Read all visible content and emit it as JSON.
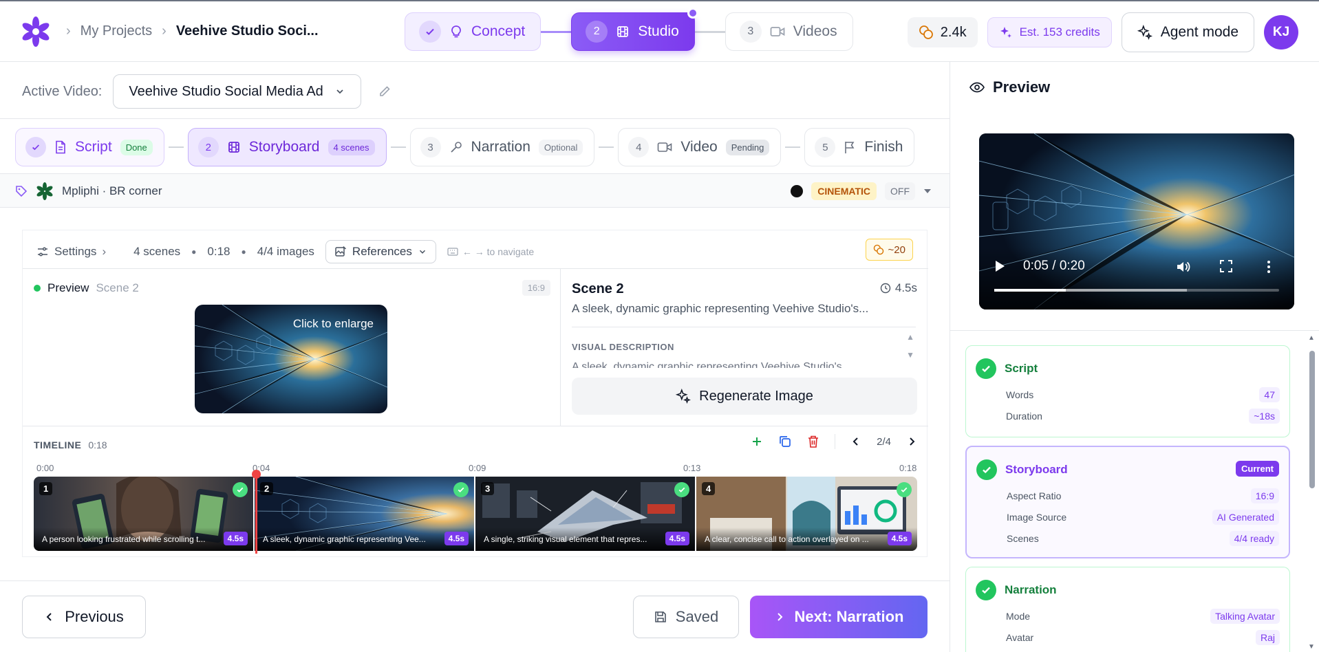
{
  "header": {
    "breadcrumb": [
      "My Projects",
      "Veehive Studio Soci..."
    ],
    "steps": [
      {
        "label": "Concept",
        "state": "done"
      },
      {
        "num": "2",
        "label": "Studio",
        "state": "active"
      },
      {
        "num": "3",
        "label": "Videos",
        "state": "pending"
      }
    ],
    "credits": "2.4k",
    "estimate": "Est. 153 credits",
    "agent_mode": "Agent mode",
    "avatar": "KJ"
  },
  "active_video": {
    "label": "Active Video:",
    "value": "Veehive Studio Social Media Ad"
  },
  "substeps": [
    {
      "label": "Script",
      "badge": "Done"
    },
    {
      "num": "2",
      "label": "Storyboard",
      "badge": "4 scenes"
    },
    {
      "num": "3",
      "label": "Narration",
      "badge": "Optional"
    },
    {
      "num": "4",
      "label": "Video",
      "badge": "Pending"
    },
    {
      "num": "5",
      "label": "Finish"
    }
  ],
  "brand_bar": {
    "text": "Mpliphi · BR corner",
    "style": "CINEMATIC",
    "toggle": "OFF"
  },
  "toolbar": {
    "settings": "Settings",
    "scenes": "4 scenes",
    "duration": "0:18",
    "images": "4/4 images",
    "references": "References",
    "hint": "← → to navigate",
    "cost": "~20"
  },
  "preview": {
    "title": "Preview",
    "scene": "Scene 2",
    "ratio": "16:9",
    "enlarge": "Click to enlarge"
  },
  "scene": {
    "title": "Scene 2",
    "duration": "4.5s",
    "summary": "A sleek, dynamic graphic representing Veehive Studio's...",
    "vd_label": "VISUAL DESCRIPTION",
    "vd_text": "A sleek, dynamic graphic representing Veehive Studio's",
    "regenerate": "Regenerate Image"
  },
  "timeline": {
    "label": "TIMELINE",
    "duration": "0:18",
    "position": "2/4",
    "ticks": [
      "0:00",
      "0:04",
      "0:09",
      "0:13",
      "0:18"
    ],
    "clips": [
      {
        "n": "1",
        "caption": "A person looking frustrated while scrolling t...",
        "dur": "4.5s"
      },
      {
        "n": "2",
        "caption": "A sleek, dynamic graphic representing Vee...",
        "dur": "4.5s"
      },
      {
        "n": "3",
        "caption": "A single, striking visual element that repres...",
        "dur": "4.5s"
      },
      {
        "n": "4",
        "caption": "A clear, concise call to action overlayed on ...",
        "dur": "4.5s"
      }
    ]
  },
  "footer": {
    "previous": "Previous",
    "saved": "Saved",
    "next": "Next: Narration"
  },
  "right_panel": {
    "title": "Preview",
    "video_time": "0:05 / 0:20",
    "progress": 0.25,
    "script": {
      "title": "Script",
      "words_label": "Words",
      "words": "47",
      "duration_label": "Duration",
      "duration": "~18s"
    },
    "storyboard": {
      "title": "Storyboard",
      "badge": "Current",
      "aspect_label": "Aspect Ratio",
      "aspect": "16:9",
      "source_label": "Image Source",
      "source": "AI Generated",
      "scenes_label": "Scenes",
      "scenes": "4/4 ready"
    },
    "narration": {
      "title": "Narration",
      "mode_label": "Mode",
      "mode": "Talking Avatar",
      "avatar_label": "Avatar",
      "avatar": "Raj"
    }
  }
}
